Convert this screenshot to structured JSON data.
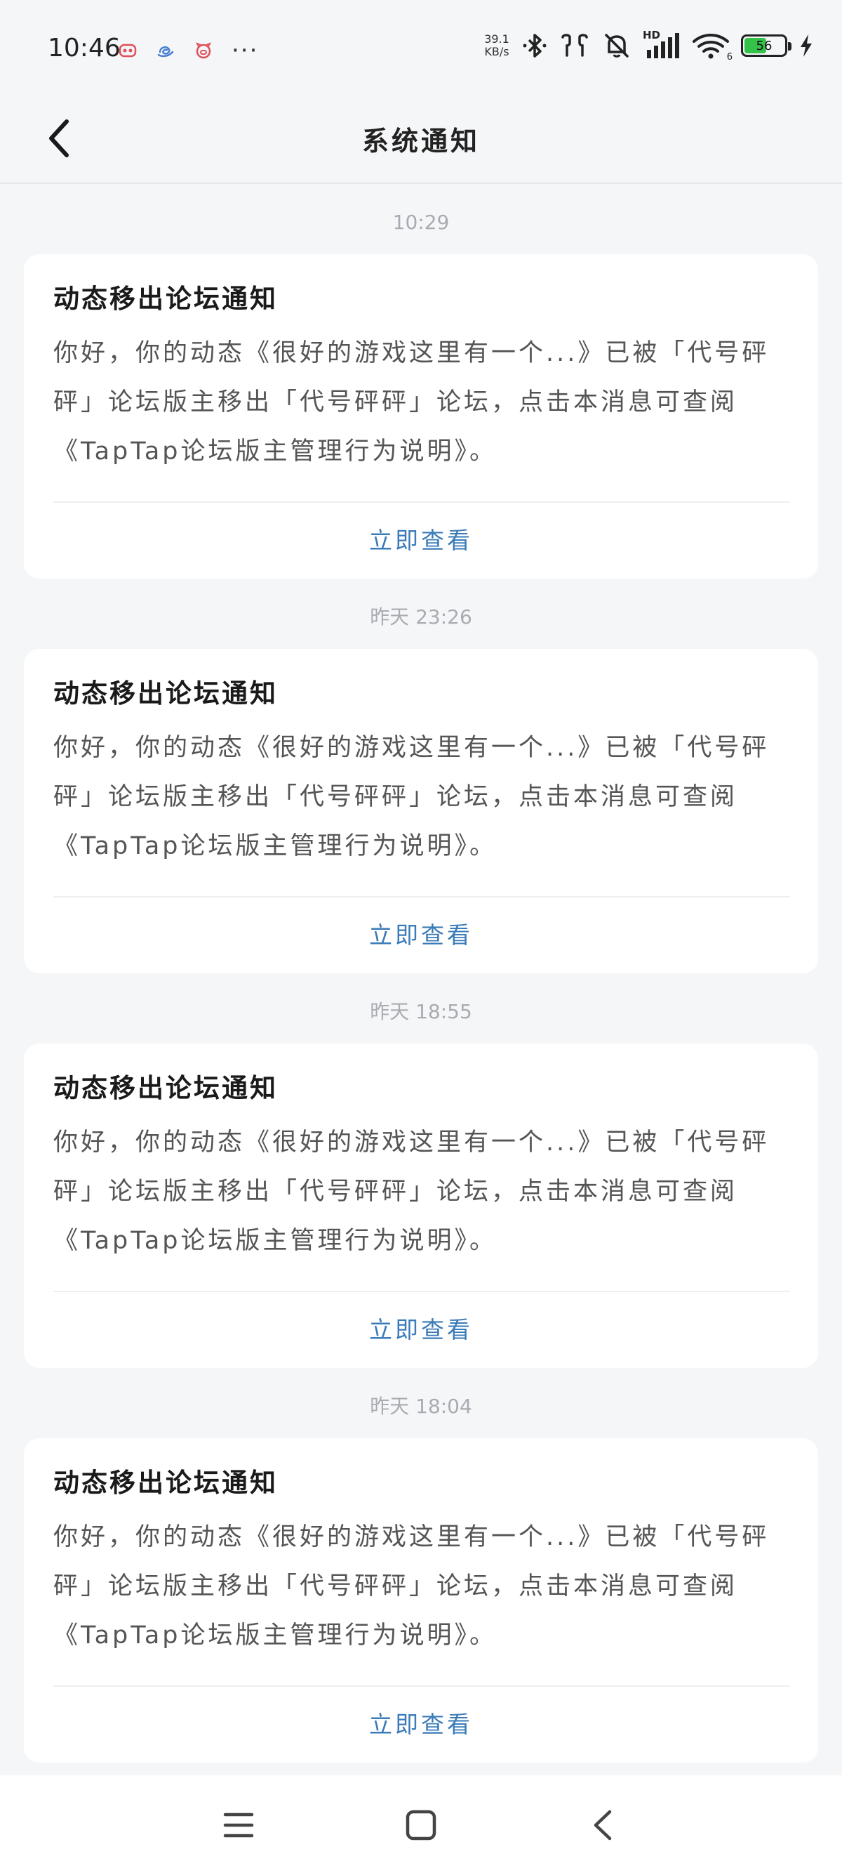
{
  "status_bar": {
    "time": "10:46",
    "more": "···",
    "net_speed_value": "39.1",
    "net_speed_unit": "KB/s",
    "network_type": "HD",
    "wifi_label": "6",
    "battery_percent": "56",
    "battery_level": 0.56
  },
  "header": {
    "title": "系统通知"
  },
  "notifications": [
    {
      "time": "10:29",
      "title": "动态移出论坛通知",
      "body": "你好，你的动态《很好的游戏这里有一个...》已被「代号砰砰」论坛版主移出「代号砰砰」论坛，点击本消息可查阅《TapTap论坛版主管理行为说明》。",
      "action": "立即查看"
    },
    {
      "time": "昨天  23:26",
      "title": "动态移出论坛通知",
      "body": "你好，你的动态《很好的游戏这里有一个...》已被「代号砰砰」论坛版主移出「代号砰砰」论坛，点击本消息可查阅《TapTap论坛版主管理行为说明》。",
      "action": "立即查看"
    },
    {
      "time": "昨天  18:55",
      "title": "动态移出论坛通知",
      "body": "你好，你的动态《很好的游戏这里有一个...》已被「代号砰砰」论坛版主移出「代号砰砰」论坛，点击本消息可查阅《TapTap论坛版主管理行为说明》。",
      "action": "立即查看"
    },
    {
      "time": "昨天  18:04",
      "title": "动态移出论坛通知",
      "body": "你好，你的动态《很好的游戏这里有一个...》已被「代号砰砰」论坛版主移出「代号砰砰」论坛，点击本消息可查阅《TapTap论坛版主管理行为说明》。",
      "action": "立即查看"
    }
  ],
  "colors": {
    "background": "#f5f6f8",
    "card": "#ffffff",
    "action": "#3a7bb8",
    "timestamp": "#a8acb2",
    "battery_fill": "#34c24a"
  },
  "icons": {
    "back": "chevron-left-icon",
    "nav_menu": "menu-icon",
    "nav_home": "home-square-icon",
    "nav_back": "back-triangle-icon"
  }
}
